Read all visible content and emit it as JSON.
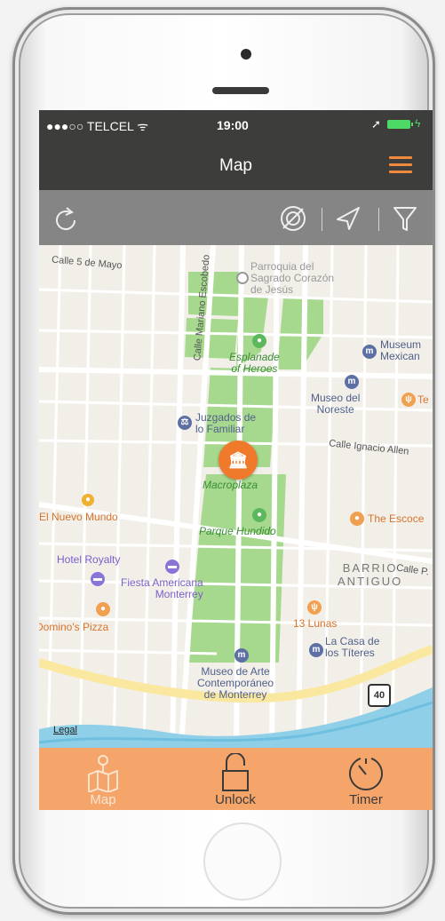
{
  "statusbar": {
    "carrier": "●●●○○ TELCEL ᯤ",
    "time": "19:00"
  },
  "navbar": {
    "title": "Map"
  },
  "map": {
    "streets": [
      "Calle 5 de Mayo",
      "Calle Mariano Escobedo",
      "Calle Ignacio Allen",
      "Calle P."
    ],
    "pois": {
      "parroquia": "Parroquia del\nSagrado Corazón\nde Jesús",
      "esplanade": "Esplanade\nof Heroes",
      "museum_mex": "Museum\nMexican",
      "museo_noreste": "Museo del\nNoreste",
      "te": "Te",
      "juzgados": "Juzgados de\nlo Familiar",
      "macroplaza": "Macroplaza",
      "nuevo_mundo": "El Nuevo Mundo",
      "parque": "Parque Hundido",
      "escoce": "The Escoce",
      "hotel": "Hotel Royalty",
      "fiesta": "Fiesta Americana\nMonterrey",
      "barrio": "BARRIO\nANTIGUO",
      "dominos": "Domino's Pizza",
      "lunas": "13 Lunas",
      "casa": "La Casa de\nlos Títeres",
      "museo_arte": "Museo de Arte\nContemporáneo\nde Monterrey",
      "highway": "40",
      "legal": "Legal"
    }
  },
  "tabs": [
    {
      "label": "Map"
    },
    {
      "label": "Unlock"
    },
    {
      "label": "Timer"
    }
  ],
  "colors": {
    "accent": "#f08a3c",
    "tabbar": "#f5a56a",
    "navbar": "#3d3d3b",
    "toolbar": "#858585",
    "park": "#a6d98e"
  }
}
